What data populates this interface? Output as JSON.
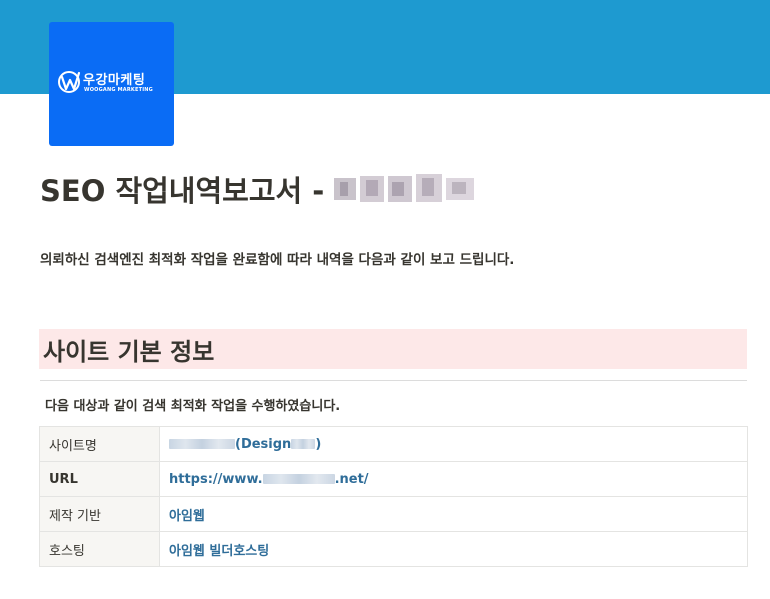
{
  "logo": {
    "title": "우강마케팅",
    "subtitle": "WOOGANG MARKETING",
    "icon": "woogang-w-logo-icon",
    "background": "#0a6cf5"
  },
  "banner": {
    "color": "#1e9ad0"
  },
  "report": {
    "title_prefix": "SEO 작업내역보고서 -",
    "intro": "의뢰하신 검색엔진 최적화 작업을 완료함에 따라 내역을 다음과 같이 보고 드립니다."
  },
  "section": {
    "heading": "사이트 기본 정보",
    "heading_bg": "#fde8e8",
    "description": "다음 대상과 같이 검색 최적화 작업을 수행하였습니다."
  },
  "table": {
    "rows": [
      {
        "label": "사이트명",
        "value_suffix": "(Design",
        "value_end": ")"
      },
      {
        "label": "URL",
        "value_prefix": "https://www.",
        "value_suffix": ".net/"
      },
      {
        "label": "제작 기반",
        "value": "아임웹"
      },
      {
        "label": "호스팅",
        "value": "아임웹 빌더호스팅"
      }
    ]
  }
}
